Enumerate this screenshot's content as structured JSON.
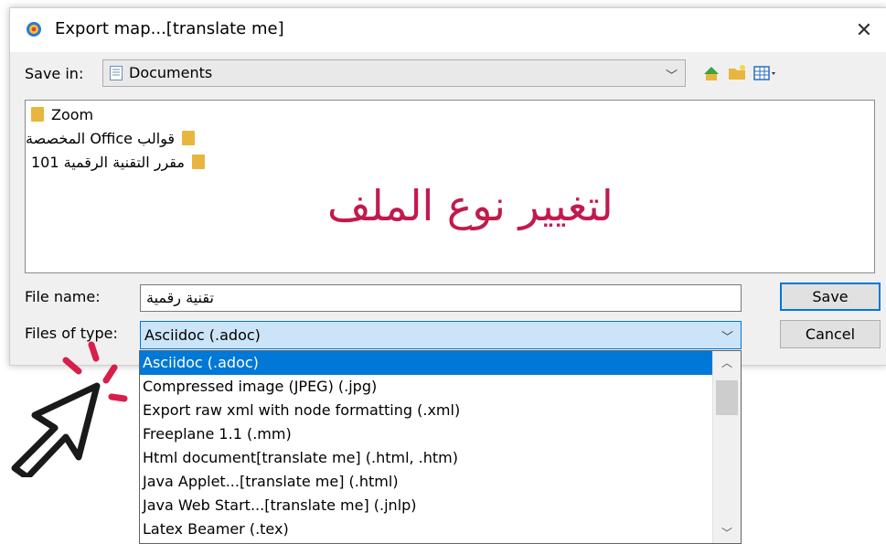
{
  "dialog": {
    "title": "Export map...[translate me]",
    "close_glyph": "✕"
  },
  "save_in": {
    "label": "Save in:",
    "value": "Documents",
    "icon": "documents-folder-icon"
  },
  "toolbar": {
    "buttons": [
      "up-one-level-icon",
      "create-new-folder-icon",
      "view-menu-icon"
    ]
  },
  "file_list": {
    "items": [
      {
        "name": "Zoom",
        "rtl": false
      },
      {
        "name": "قوالب Office المخصصة",
        "rtl": true
      },
      {
        "name": "مقرر التقنية الرقمية 101",
        "rtl": true
      }
    ]
  },
  "overlay": {
    "caption": "لتغيير نوع الملف",
    "color": "#c21a4c"
  },
  "file_name": {
    "label": "File name:",
    "value": "تقنية رقمية"
  },
  "files_of_type": {
    "label": "Files of type:",
    "value": "Asciidoc (.adoc)",
    "options": [
      "Asciidoc (.adoc)",
      "Compressed image (JPEG) (.jpg)",
      "Export raw xml with node formatting (.xml)",
      "Freeplane 1.1 (.mm)",
      "Html document[translate me] (.html, .htm)",
      "Java Applet...[translate me] (.html)",
      "Java Web Start...[translate me] (.jnlp)",
      "Latex Beamer (.tex)"
    ],
    "selected_index": 0
  },
  "buttons": {
    "save": "Save",
    "cancel": "Cancel"
  },
  "colors": {
    "accent": "#0078d7",
    "folder": "#e8b53e"
  }
}
